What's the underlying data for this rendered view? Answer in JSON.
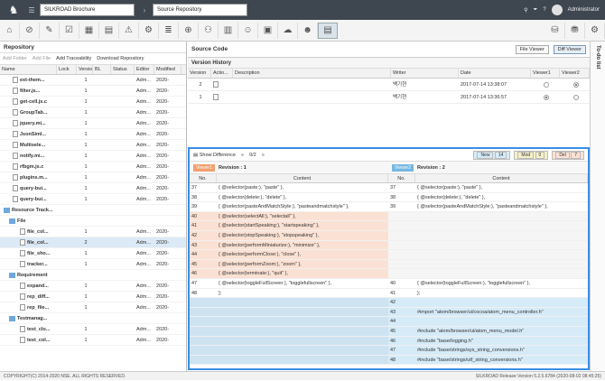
{
  "header": {
    "project": "SILKROAD Brochure",
    "section": "Source Repository",
    "user": "Administrator"
  },
  "left": {
    "title": "Repository",
    "actions": [
      "Add Folder",
      "Add File",
      "Add Traceability",
      "Download Repository"
    ],
    "columns": [
      "Name",
      "Lock",
      "Version",
      "BL",
      "Status",
      "Editor",
      "Modified"
    ],
    "rows": [
      {
        "name": "ext-them...",
        "ver": "1",
        "ed": "Adm...",
        "mod": "2020-"
      },
      {
        "name": "filter.js...",
        "ver": "1",
        "ed": "Adm...",
        "mod": "2020-"
      },
      {
        "name": "get-cell.js.c",
        "ver": "1",
        "ed": "Adm...",
        "mod": "2020-"
      },
      {
        "name": "GroupTab...",
        "ver": "1",
        "ed": "Adm...",
        "mod": "2020-"
      },
      {
        "name": "jquery.mi...",
        "ver": "1",
        "ed": "Adm...",
        "mod": "2020-"
      },
      {
        "name": "JsonSiml...",
        "ver": "1",
        "ed": "Adm...",
        "mod": "2020-"
      },
      {
        "name": "Multisele...",
        "ver": "1",
        "ed": "Adm...",
        "mod": "2020-"
      },
      {
        "name": "notify.mi...",
        "ver": "1",
        "ed": "Adm...",
        "mod": "2020-"
      },
      {
        "name": "rfbgm.js.c",
        "ver": "1",
        "ed": "Adm...",
        "mod": "2020-"
      },
      {
        "name": "plugins.m...",
        "ver": "1",
        "ed": "Adm...",
        "mod": "2020-"
      },
      {
        "name": "query-bui...",
        "ver": "1",
        "ed": "Adm...",
        "mod": "2020-"
      },
      {
        "name": "query-bui...",
        "ver": "1",
        "ed": "Adm...",
        "mod": "2020-"
      },
      {
        "name": "Resource Track...",
        "ver": "",
        "ed": "",
        "mod": ""
      },
      {
        "name": "File",
        "ver": "",
        "ed": "",
        "mod": ""
      },
      {
        "name": "file_col...",
        "ver": "1",
        "ed": "Adm...",
        "mod": "2020-"
      },
      {
        "name": "file_col...",
        "ver": "2",
        "ed": "Adm...",
        "mod": "2020-"
      },
      {
        "name": "file_sho...",
        "ver": "1",
        "ed": "Adm...",
        "mod": "2020-"
      },
      {
        "name": "tracker...",
        "ver": "1",
        "ed": "Adm...",
        "mod": "2020-"
      },
      {
        "name": "Requirement",
        "ver": "",
        "ed": "",
        "mod": ""
      },
      {
        "name": "expand...",
        "ver": "1",
        "ed": "Adm...",
        "mod": "2020-"
      },
      {
        "name": "rep_diff...",
        "ver": "1",
        "ed": "Adm...",
        "mod": "2020-"
      },
      {
        "name": "rep_file...",
        "ver": "1",
        "ed": "Adm...",
        "mod": "2020-"
      },
      {
        "name": "Testmanag...",
        "ver": "",
        "ed": "",
        "mod": ""
      },
      {
        "name": "test_clo...",
        "ver": "1",
        "ed": "Adm...",
        "mod": "2020-"
      },
      {
        "name": "test_col...",
        "ver": "1",
        "ed": "Adm...",
        "mod": "2020-"
      }
    ]
  },
  "source": {
    "title": "Source Code",
    "file_viewer": "File Viewer",
    "diff_viewer": "Diff Viewer",
    "history_title": "Version History",
    "hcols": [
      "Version",
      "Actio...",
      "Description",
      "Writer",
      "Date",
      "Viewer1",
      "Viewer2"
    ],
    "history": [
      {
        "v": "2",
        "w": "백기현",
        "d": "2017-07-14 13:38:07"
      },
      {
        "v": "1",
        "w": "백기현",
        "d": "2017-07-14 13:36:57"
      }
    ]
  },
  "diff": {
    "show": "Show Difference",
    "nav": "0/2",
    "legend": {
      "new": "New",
      "newc": "14",
      "mod": "Mod",
      "modc": "0",
      "del": "Del",
      "delc": "7"
    },
    "v1": "Viewer1",
    "r1": "Revision : 1",
    "v2": "Viewer2",
    "r2": "Revision : 2",
    "colno": "No.",
    "colc": "Content",
    "rows": [
      {
        "t": "",
        "ln": "37",
        "l": "{ @selector(paste:), \"paste\" },",
        "rn": "37",
        "r": "{ @selector(paste:), \"paste\" },"
      },
      {
        "t": "",
        "ln": "38",
        "l": "{ @selector(delete:), \"delete\" },",
        "rn": "38",
        "r": "{ @selector(delete:), \"delete\" },"
      },
      {
        "t": "",
        "ln": "39",
        "l": "{ @selector(pasteAndMatchStyle:), \"pasteandmatchstyle\" },",
        "rn": "39",
        "r": "{ @selector(pasteAndMatchStyle:), \"pasteandmatchstyle\" },"
      },
      {
        "t": "del",
        "ln": "40",
        "l": "{ @selector(selectAll:), \"selectall\" },",
        "rn": "",
        "r": ""
      },
      {
        "t": "del",
        "ln": "41",
        "l": "{ @selector(startSpeaking:), \"startspeaking\" },",
        "rn": "",
        "r": ""
      },
      {
        "t": "del",
        "ln": "42",
        "l": "{ @selector(stopSpeaking:), \"stopspeaking\" },",
        "rn": "",
        "r": ""
      },
      {
        "t": "del",
        "ln": "43",
        "l": "{ @selector(performMiniaturize:), \"minimize\" },",
        "rn": "",
        "r": ""
      },
      {
        "t": "del",
        "ln": "44",
        "l": "{ @selector(performClose:), \"close\" },",
        "rn": "",
        "r": ""
      },
      {
        "t": "del",
        "ln": "45",
        "l": "{ @selector(performZoom:), \"zoom\" },",
        "rn": "",
        "r": ""
      },
      {
        "t": "del",
        "ln": "46",
        "l": "{ @selector(terminate:), \"quit\" },",
        "rn": "",
        "r": ""
      },
      {
        "t": "",
        "ln": "47",
        "l": "{ @selector(toggleFullScreen:), \"togglefullscreen\" },",
        "rn": "40",
        "r": "{ @selector(toggleFullScreen:), \"togglefullscreen\" },"
      },
      {
        "t": "",
        "ln": "48",
        "l": "};",
        "rn": "41",
        "r": "};"
      },
      {
        "t": "new",
        "ln": "",
        "l": "",
        "rn": "42",
        "r": ""
      },
      {
        "t": "new",
        "ln": "",
        "l": "",
        "rn": "43",
        "r": "#import \"atom/browser/ui/cocoa/atom_menu_controller.h\""
      },
      {
        "t": "new",
        "ln": "",
        "l": "",
        "rn": "44",
        "r": ""
      },
      {
        "t": "new",
        "ln": "",
        "l": "",
        "rn": "45",
        "r": "#include \"atom/browser/ui/atom_menu_model.h\""
      },
      {
        "t": "new",
        "ln": "",
        "l": "",
        "rn": "46",
        "r": "#include \"base/logging.h\""
      },
      {
        "t": "new",
        "ln": "",
        "l": "",
        "rn": "47",
        "r": "#include \"base/strings/sys_string_conversions.h\""
      },
      {
        "t": "new",
        "ln": "",
        "l": "",
        "rn": "48",
        "r": "#include \"base/strings/utf_string_conversions.h\""
      }
    ]
  },
  "todo": "To-do list",
  "status": {
    "left": "COPYRIGHT(C) 2014-2020 NSE. ALL RIGHTS RESERVED.",
    "right": "SILKROAD Release Version 5.2.5.6784 (2020-08-02 08:45:25)"
  }
}
